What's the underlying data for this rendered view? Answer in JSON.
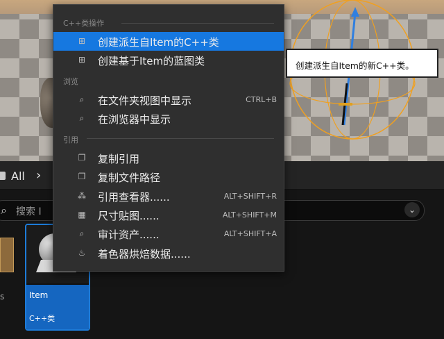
{
  "menu": {
    "sections": [
      {
        "title": "C++类操作"
      },
      {
        "title": "浏览"
      },
      {
        "title": "引用"
      }
    ],
    "items": [
      {
        "label": "创建派生自Item的C++类",
        "icon": "cpp-class-icon",
        "shortcut": "",
        "highlighted": true
      },
      {
        "label": "创建基于Item的蓝图类",
        "icon": "cpp-class-icon",
        "shortcut": ""
      },
      {
        "label": "在文件夹视图中显示",
        "icon": "folder-search-icon",
        "shortcut": "CTRL+B"
      },
      {
        "label": "在浏览器中显示",
        "icon": "folder-search-icon",
        "shortcut": ""
      },
      {
        "label": "复制引用",
        "icon": "copy-icon",
        "shortcut": ""
      },
      {
        "label": "复制文件路径",
        "icon": "copy-icon",
        "shortcut": ""
      },
      {
        "label": "引用查看器......",
        "icon": "reference-viewer-icon",
        "shortcut": "ALT+SHIFT+R"
      },
      {
        "label": "尺寸贴图......",
        "icon": "size-map-icon",
        "shortcut": "ALT+SHIFT+M"
      },
      {
        "label": "审计资产......",
        "icon": "audit-icon",
        "shortcut": "ALT+SHIFT+A"
      },
      {
        "label": "着色器烘焙数据......",
        "icon": "shader-icon",
        "shortcut": ""
      }
    ]
  },
  "tooltip": {
    "text": "创建派生自Item的新C++类。"
  },
  "content_browser": {
    "breadcrumb": "All",
    "search_placeholder": "搜索 I",
    "left_tile_label": "s",
    "asset": {
      "name": "Item",
      "type": "C++类"
    }
  },
  "colors": {
    "highlight": "#1678e0",
    "asset_accent": "#1566c0"
  }
}
